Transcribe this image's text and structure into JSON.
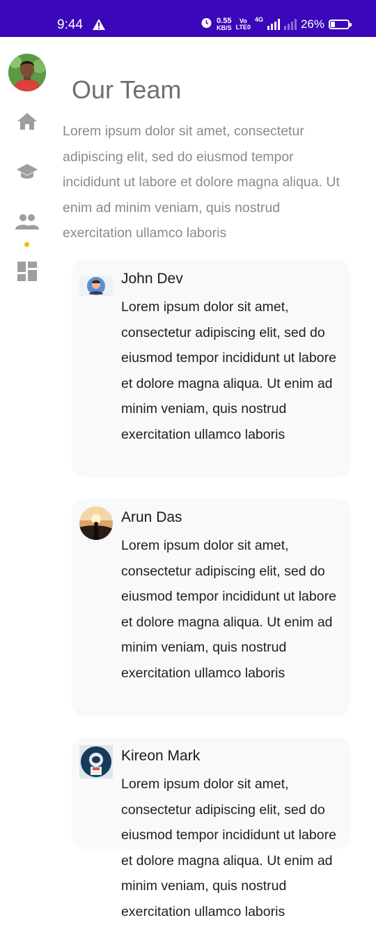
{
  "status_bar": {
    "time": "9:44",
    "speed_value": "0.55",
    "speed_unit": "KB/S",
    "volte_top": "Vo",
    "volte_bottom": "LTE0",
    "network": "4G",
    "battery": "26%",
    "battery_level": 0.26
  },
  "nav": {
    "items": [
      "home-icon",
      "school-icon",
      "people-icon",
      "dashboard-icon"
    ],
    "active": "people-icon",
    "active_color": "#f5b800"
  },
  "page": {
    "title": "Our Team",
    "intro": "Lorem ipsum dolor sit amet, consectetur adipiscing elit, sed do eiusmod tempor incididunt ut labore et dolore magna aliqua. Ut enim ad minim veniam, quis nostrud exercitation ullamco laboris"
  },
  "team": [
    {
      "name": "John Dev",
      "bio": "Lorem ipsum dolor sit amet, consectetur adipiscing elit, sed do eiusmod tempor incididunt ut labore et dolore magna aliqua. Ut enim ad minim veniam, quis nostrud exercitation ullamco laboris"
    },
    {
      "name": "Arun Das",
      "bio": "Lorem ipsum dolor sit amet, consectetur adipiscing elit, sed do eiusmod tempor incididunt ut labore et dolore magna aliqua. Ut enim ad minim veniam, quis nostrud exercitation ullamco laboris"
    },
    {
      "name": "Kireon Mark",
      "bio": "Lorem ipsum dolor sit amet, consectetur adipiscing elit, sed do eiusmod tempor incididunt ut labore et dolore magna aliqua. Ut enim ad minim veniam, quis nostrud exercitation ullamco laboris"
    }
  ],
  "colors": {
    "status_bar": "#3a08b8",
    "title": "#6e6e6e",
    "card_bg": "#f9f9f9"
  }
}
